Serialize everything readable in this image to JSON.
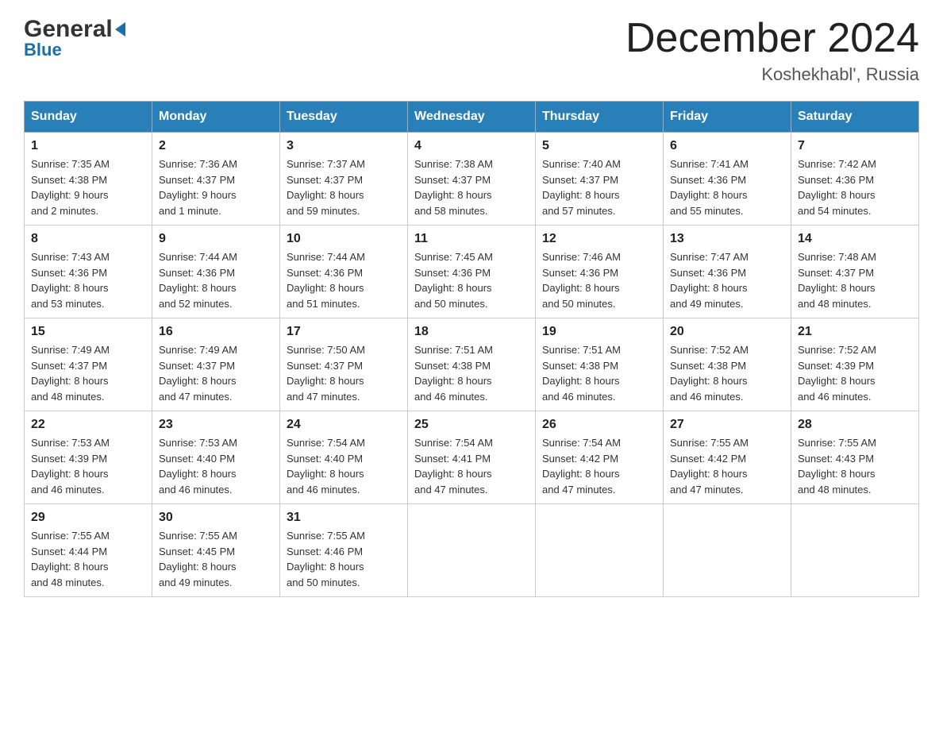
{
  "logo": {
    "general": "General",
    "blue": "Blue",
    "arrow_alt": "logo arrow"
  },
  "header": {
    "month_title": "December 2024",
    "location": "Koshekhabl', Russia"
  },
  "weekdays": [
    "Sunday",
    "Monday",
    "Tuesday",
    "Wednesday",
    "Thursday",
    "Friday",
    "Saturday"
  ],
  "weeks": [
    [
      {
        "day": "1",
        "sunrise": "7:35 AM",
        "sunset": "4:38 PM",
        "daylight": "9 hours and 2 minutes."
      },
      {
        "day": "2",
        "sunrise": "7:36 AM",
        "sunset": "4:37 PM",
        "daylight": "9 hours and 1 minute."
      },
      {
        "day": "3",
        "sunrise": "7:37 AM",
        "sunset": "4:37 PM",
        "daylight": "8 hours and 59 minutes."
      },
      {
        "day": "4",
        "sunrise": "7:38 AM",
        "sunset": "4:37 PM",
        "daylight": "8 hours and 58 minutes."
      },
      {
        "day": "5",
        "sunrise": "7:40 AM",
        "sunset": "4:37 PM",
        "daylight": "8 hours and 57 minutes."
      },
      {
        "day": "6",
        "sunrise": "7:41 AM",
        "sunset": "4:36 PM",
        "daylight": "8 hours and 55 minutes."
      },
      {
        "day": "7",
        "sunrise": "7:42 AM",
        "sunset": "4:36 PM",
        "daylight": "8 hours and 54 minutes."
      }
    ],
    [
      {
        "day": "8",
        "sunrise": "7:43 AM",
        "sunset": "4:36 PM",
        "daylight": "8 hours and 53 minutes."
      },
      {
        "day": "9",
        "sunrise": "7:44 AM",
        "sunset": "4:36 PM",
        "daylight": "8 hours and 52 minutes."
      },
      {
        "day": "10",
        "sunrise": "7:44 AM",
        "sunset": "4:36 PM",
        "daylight": "8 hours and 51 minutes."
      },
      {
        "day": "11",
        "sunrise": "7:45 AM",
        "sunset": "4:36 PM",
        "daylight": "8 hours and 50 minutes."
      },
      {
        "day": "12",
        "sunrise": "7:46 AM",
        "sunset": "4:36 PM",
        "daylight": "8 hours and 50 minutes."
      },
      {
        "day": "13",
        "sunrise": "7:47 AM",
        "sunset": "4:36 PM",
        "daylight": "8 hours and 49 minutes."
      },
      {
        "day": "14",
        "sunrise": "7:48 AM",
        "sunset": "4:37 PM",
        "daylight": "8 hours and 48 minutes."
      }
    ],
    [
      {
        "day": "15",
        "sunrise": "7:49 AM",
        "sunset": "4:37 PM",
        "daylight": "8 hours and 48 minutes."
      },
      {
        "day": "16",
        "sunrise": "7:49 AM",
        "sunset": "4:37 PM",
        "daylight": "8 hours and 47 minutes."
      },
      {
        "day": "17",
        "sunrise": "7:50 AM",
        "sunset": "4:37 PM",
        "daylight": "8 hours and 47 minutes."
      },
      {
        "day": "18",
        "sunrise": "7:51 AM",
        "sunset": "4:38 PM",
        "daylight": "8 hours and 46 minutes."
      },
      {
        "day": "19",
        "sunrise": "7:51 AM",
        "sunset": "4:38 PM",
        "daylight": "8 hours and 46 minutes."
      },
      {
        "day": "20",
        "sunrise": "7:52 AM",
        "sunset": "4:38 PM",
        "daylight": "8 hours and 46 minutes."
      },
      {
        "day": "21",
        "sunrise": "7:52 AM",
        "sunset": "4:39 PM",
        "daylight": "8 hours and 46 minutes."
      }
    ],
    [
      {
        "day": "22",
        "sunrise": "7:53 AM",
        "sunset": "4:39 PM",
        "daylight": "8 hours and 46 minutes."
      },
      {
        "day": "23",
        "sunrise": "7:53 AM",
        "sunset": "4:40 PM",
        "daylight": "8 hours and 46 minutes."
      },
      {
        "day": "24",
        "sunrise": "7:54 AM",
        "sunset": "4:40 PM",
        "daylight": "8 hours and 46 minutes."
      },
      {
        "day": "25",
        "sunrise": "7:54 AM",
        "sunset": "4:41 PM",
        "daylight": "8 hours and 47 minutes."
      },
      {
        "day": "26",
        "sunrise": "7:54 AM",
        "sunset": "4:42 PM",
        "daylight": "8 hours and 47 minutes."
      },
      {
        "day": "27",
        "sunrise": "7:55 AM",
        "sunset": "4:42 PM",
        "daylight": "8 hours and 47 minutes."
      },
      {
        "day": "28",
        "sunrise": "7:55 AM",
        "sunset": "4:43 PM",
        "daylight": "8 hours and 48 minutes."
      }
    ],
    [
      {
        "day": "29",
        "sunrise": "7:55 AM",
        "sunset": "4:44 PM",
        "daylight": "8 hours and 48 minutes."
      },
      {
        "day": "30",
        "sunrise": "7:55 AM",
        "sunset": "4:45 PM",
        "daylight": "8 hours and 49 minutes."
      },
      {
        "day": "31",
        "sunrise": "7:55 AM",
        "sunset": "4:46 PM",
        "daylight": "8 hours and 50 minutes."
      },
      null,
      null,
      null,
      null
    ]
  ],
  "labels": {
    "sunrise": "Sunrise:",
    "sunset": "Sunset:",
    "daylight": "Daylight:"
  },
  "colors": {
    "header_bg": "#2980b9",
    "border": "#aaaaaa",
    "accent_blue": "#1a6fa8"
  }
}
